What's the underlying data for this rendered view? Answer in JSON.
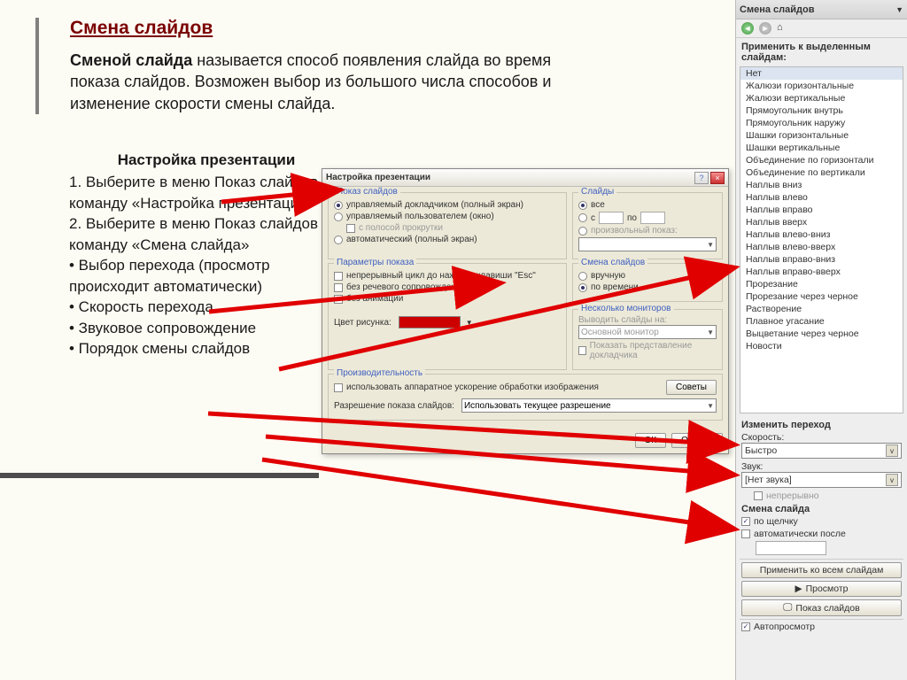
{
  "page": {
    "title": "Смена слайдов",
    "intro_bold": "Сменой слайда",
    "intro_rest": " называется способ появления слайда во время показа слайдов. Возможен выбор из большого числа способов и изменение скорости смены слайда."
  },
  "instructions": {
    "heading": "Настройка презентации",
    "step1": "1. Выберите в меню Показ слайдов команду «Настройка презентации»",
    "step2": "2. Выберите в меню Показ слайдов команду «Смена слайда»",
    "b1": "• Выбор перехода (просмотр происходит автоматически)",
    "b2": "• Скорость перехода",
    "b3": "• Звуковое сопровождение",
    "b4": "• Порядок смены слайдов"
  },
  "dialog": {
    "title": "Настройка презентации",
    "group_show": "Показ слайдов",
    "r_presenter": "управляемый докладчиком (полный экран)",
    "r_user": "управляемый пользователем (окно)",
    "chk_scroll": "с полосой прокрутки",
    "r_auto": "автоматический (полный экран)",
    "group_params": "Параметры показа",
    "chk_loop": "непрерывный цикл до нажатия клавиши \"Esc\"",
    "chk_nosound": "без речевого сопровождения",
    "chk_noanim": "без анимации",
    "color_label": "Цвет рисунка:",
    "group_slides": "Слайды",
    "r_all": "все",
    "r_from": "с",
    "r_to": "по",
    "r_custom": "произвольный показ:",
    "group_change": "Смена слайдов",
    "r_manual": "вручную",
    "r_time": "по времени",
    "group_monitors": "Несколько мониторов",
    "mon_label": "Выводить слайды на:",
    "mon_select": "Основной монитор",
    "chk_presenter_view": "Показать представление докладчика",
    "group_perf": "Производительность",
    "chk_hwaccel": "использовать аппаратное ускорение обработки изображения",
    "tips_btn": "Советы",
    "res_label": "Разрешение показа слайдов:",
    "res_value": "Использовать текущее разрешение",
    "ok": "ОК",
    "cancel": "Отмена"
  },
  "taskpane": {
    "header": "Смена слайдов",
    "apply_label": "Применить к выделенным слайдам:",
    "items": [
      "Нет",
      "Жалюзи горизонтальные",
      "Жалюзи вертикальные",
      "Прямоугольник внутрь",
      "Прямоугольник наружу",
      "Шашки горизонтальные",
      "Шашки вертикальные",
      "Объединение по горизонтали",
      "Объединение по вертикали",
      "Наплыв вниз",
      "Наплыв влево",
      "Наплыв вправо",
      "Наплыв вверх",
      "Наплыв влево-вниз",
      "Наплыв влево-вверх",
      "Наплыв вправо-вниз",
      "Наплыв вправо-вверх",
      "Прорезание",
      "Прорезание через черное",
      "Растворение",
      "Плавное угасание",
      "Выцветание через черное",
      "Новости"
    ],
    "modify_title": "Изменить переход",
    "speed_label": "Скорость:",
    "speed_value": "Быстро",
    "sound_label": "Звук:",
    "sound_value": "[Нет звука]",
    "chk_loop_sound": "непрерывно",
    "advance_title": "Смена слайда",
    "chk_click": "по щелчку",
    "chk_auto_after": "автоматически после",
    "btn_apply_all": "Применить ко всем слайдам",
    "btn_play": "Просмотр",
    "btn_slideshow": "Показ слайдов",
    "chk_autopreview": "Автопросмотр"
  }
}
